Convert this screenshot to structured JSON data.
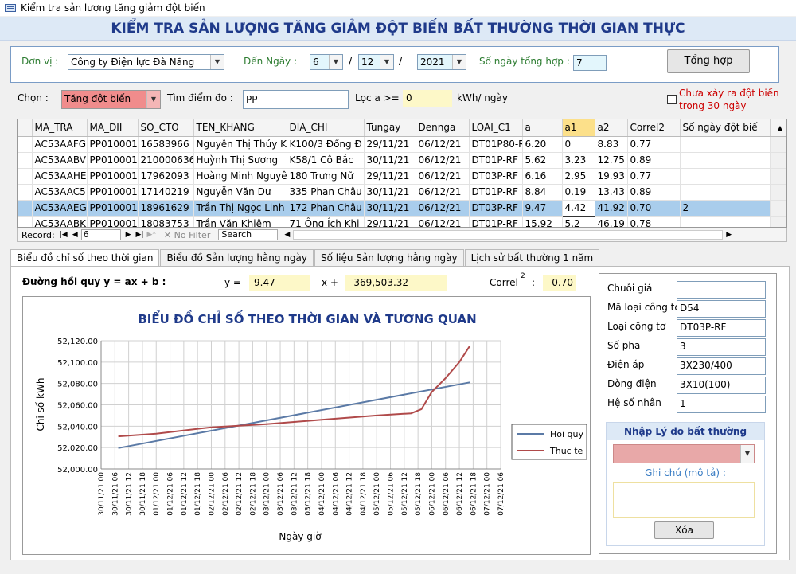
{
  "window_title": "Kiểm tra sản lượng tăng giảm đột biến",
  "main_title": "KIỂM TRA SẢN LƯỢNG TĂNG GIẢM ĐỘT BIẾN BẤT THƯỜNG THỜI GIAN THỰC",
  "filter": {
    "donvi_label": "Đơn vị :",
    "donvi_value": "Công ty Điện lực Đà Nẵng",
    "denngay_label": "Đến Ngày :",
    "day": "6",
    "month": "12",
    "year": "2021",
    "sep": "/",
    "songay_label": "Số ngày tổng hợp :",
    "songay_value": "7",
    "tonghop_label": "Tổng hợp"
  },
  "chon": {
    "label": "Chọn :",
    "value": "Tăng đột biến",
    "timdiem_label": "Tìm điểm đo :",
    "timdiem_value": "PP",
    "loc_label": "Lọc a >=",
    "loc_value": "0",
    "unit": "kWh/ ngày",
    "checkbox_label_1": "Chưa xảy ra đột biến",
    "checkbox_label_2": "trong 30 ngày"
  },
  "grid": {
    "headers": [
      "MA_TRA",
      "MA_DII",
      "SO_CTO",
      "TEN_KHANG",
      "DIA_CHI",
      "Tungay",
      "Dennga",
      "LOAI_C1",
      "a",
      "a1",
      "a2",
      "Correl2",
      "Số ngày đột biế"
    ],
    "rows": [
      [
        "AC53AAFG",
        "PP0100010",
        "16583966",
        "Nguyễn Thị Thúy K",
        "K100/3  Đống Đ",
        "29/11/21",
        "06/12/21",
        "DT01P80-R",
        "6.20",
        "0",
        "8.83",
        "0.77",
        ""
      ],
      [
        "AC53AABV",
        "PP0100010",
        "2100006364",
        "Huỳnh Thị Sương",
        "K58/1  Cô Bắc",
        "30/11/21",
        "06/12/21",
        "DT01P-RF",
        "5.62",
        "3.23",
        "12.75",
        "0.89",
        ""
      ],
      [
        "AC53AAHE",
        "PP0100010",
        "17962093",
        "Hoàng Minh Nguyê",
        "180  Trưng Nữ",
        "29/11/21",
        "06/12/21",
        "DT03P-RF",
        "6.16",
        "2.95",
        "19.93",
        "0.77",
        ""
      ],
      [
        "AC53AAC5",
        "PP0100010",
        "17140219",
        "Nguyễn Văn Dư",
        "335  Phan Châu",
        "30/11/21",
        "06/12/21",
        "DT01P-RF",
        "8.84",
        "0.19",
        "13.43",
        "0.89",
        ""
      ],
      [
        "AC53AAEG",
        "PP0100010",
        "18961629",
        "Trần Thị Ngọc Linh",
        "172 Phan Châu",
        "30/11/21",
        "06/12/21",
        "DT03P-RF",
        "9.47",
        "4.42",
        "41.92",
        "0.70",
        "2"
      ],
      [
        "AC53AABK",
        "PP0100010",
        "18083753",
        "Trần Văn Khiêm",
        "71  Ông Ích Khi",
        "29/11/21",
        "06/12/21",
        "DT01P-RF",
        "15.92",
        "5.2",
        "46.19",
        "0.78",
        ""
      ]
    ],
    "nav": {
      "record_label": "Record:",
      "record_value": "6",
      "nofilter": "No Filter",
      "search": "Search"
    }
  },
  "tabs": [
    "Biểu đồ chỉ số theo thời gian",
    "Biểu đồ Sản lượng hằng ngày",
    "Số liệu Sản lượng hằng ngày",
    "Lịch sử bất thường 1 năm"
  ],
  "regression": {
    "label": "Đường hồi quy y = ax + b :",
    "y_label": "y =",
    "a": "9.47",
    "x_label": "x +",
    "b": "-369,503.32",
    "correl_label": "Correl",
    "correl_exp": "2",
    "correl_sep": ":",
    "correl_value": "0.70"
  },
  "chart_data": {
    "type": "line",
    "title": "BIỂU ĐỒ CHỈ SỐ THEO THỜI GIAN VÀ TƯƠNG QUAN",
    "ylabel": "Chỉ số kWh",
    "xlabel": "Ngày giờ",
    "ylim": [
      52000,
      52120
    ],
    "yticks": [
      "52,000.00",
      "52,020.00",
      "52,040.00",
      "52,060.00",
      "52,080.00",
      "52,100.00",
      "52,120.00"
    ],
    "xticks": [
      "30/11/21 00",
      "30/11/21 06",
      "30/11/21 12",
      "30/11/21 18",
      "01/12/21 00",
      "01/12/21 06",
      "01/12/21 12",
      "01/12/21 18",
      "02/12/21 00",
      "02/12/21 06",
      "02/12/21 12",
      "02/12/21 18",
      "03/12/21 00",
      "03/12/21 06",
      "03/12/21 12",
      "03/12/21 18",
      "04/12/21 00",
      "04/12/21 06",
      "04/12/21 12",
      "04/12/21 18",
      "05/12/21 00",
      "05/12/21 06",
      "05/12/21 12",
      "05/12/21 18",
      "06/12/21 00",
      "06/12/21 06",
      "06/12/21 12",
      "06/12/21 18",
      "07/12/21 00",
      "07/12/21 06"
    ],
    "series": [
      {
        "name": "Hoi quy",
        "color": "#5b7aa6",
        "x": [
          1.25,
          26.75
        ],
        "y": [
          52019.5,
          52081
        ]
      },
      {
        "name": "Thuc te",
        "color": "#b04a4a",
        "x": [
          1.25,
          4,
          8,
          12,
          16,
          20,
          22.5,
          23.25,
          24,
          25,
          26,
          26.75
        ],
        "y": [
          52030.5,
          52033,
          52039,
          52042,
          52046,
          52050,
          52052,
          52056,
          52072,
          52085,
          52100,
          52115
        ]
      }
    ],
    "legend": "right"
  },
  "side": {
    "chuoigia_label": "Chuỗi giá",
    "chuoigia_value": "",
    "maloai_label": "Mã loại công tơ",
    "maloai_value": "D54",
    "loai_label": "Loại công tơ",
    "loai_value": "DT03P-RF",
    "sopha_label": "Số pha",
    "sopha_value": "3",
    "dienap_label": "Điện áp",
    "dienap_value": "3X230/400",
    "dongdien_label": "Dòng điện",
    "dongdien_value": "3X10(100)",
    "heso_label": "Hệ số nhân",
    "heso_value": "1",
    "nhap_label": "Nhập Lý do bất thường",
    "ghichu_label": "Ghi chú (mô tả) :",
    "xoa_label": "Xóa"
  }
}
